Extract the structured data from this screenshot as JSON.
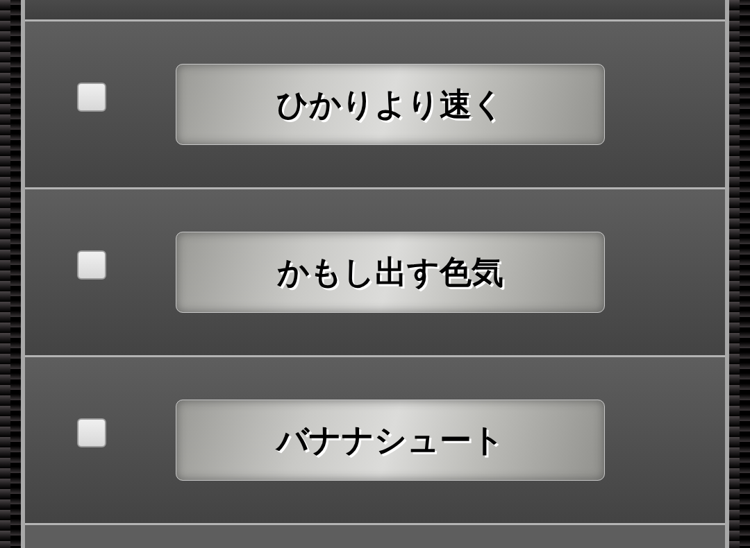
{
  "rows": [
    {
      "label": "ひかりより速く",
      "checked": false
    },
    {
      "label": "かもし出す色気",
      "checked": false
    },
    {
      "label": "バナナシュート",
      "checked": false
    }
  ]
}
